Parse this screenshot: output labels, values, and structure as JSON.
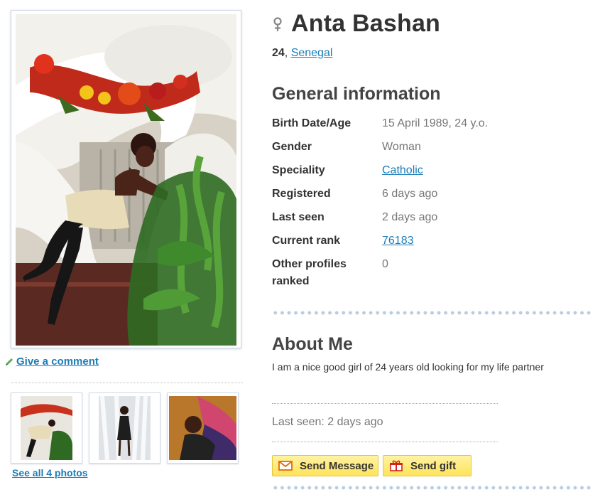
{
  "profile": {
    "name": "Anta Bashan",
    "age": "24",
    "country": "Senegal",
    "gender_icon": "female-icon"
  },
  "general": {
    "title": "General information",
    "rows": [
      {
        "label": "Birth Date/Age",
        "value": "15 April 1989, 24 y.o."
      },
      {
        "label": "Gender",
        "value": "Woman"
      },
      {
        "label": "Speciality",
        "value": "Catholic"
      },
      {
        "label": "Registered",
        "value": "6 days ago"
      },
      {
        "label": "Last seen",
        "value": "2 days ago"
      },
      {
        "label": "Current rank",
        "value": "76183"
      },
      {
        "label": "Other profiles ranked",
        "value": "0"
      }
    ]
  },
  "about": {
    "title": "About Me",
    "text": "I am a nice good girl of 24 years old looking for my life partner",
    "last_seen": "Last seen: 2 days ago"
  },
  "actions": {
    "send_message": "Send Message",
    "send_gift": "Send gift"
  },
  "photos": {
    "comment_link": "Give a comment",
    "see_all": "See all 4 photos"
  },
  "colors": {
    "link": "#1b7db8",
    "button": "#ffe35a",
    "separator_dots": "#b9cde0"
  }
}
